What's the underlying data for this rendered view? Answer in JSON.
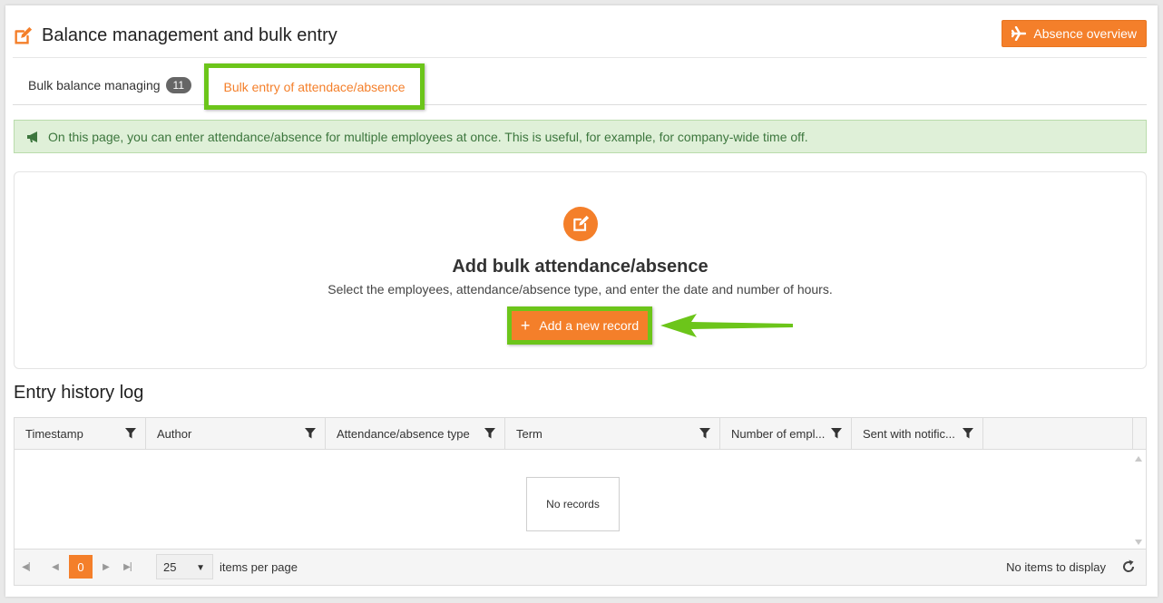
{
  "header": {
    "title": "Balance management and bulk entry",
    "absence_button": "Absence overview"
  },
  "tabs": [
    {
      "label": "Bulk balance managing",
      "badge": "11"
    },
    {
      "label": "Bulk entry of attendace/absence"
    }
  ],
  "info_text": "On this page, you can enter attendance/absence for multiple employees at once. This is useful, for example, for company-wide time off.",
  "card": {
    "title": "Add bulk attendance/absence",
    "description": "Select the employees, attendance/absence type, and enter the date and number of hours.",
    "add_button": "Add a new record"
  },
  "log": {
    "title": "Entry history log",
    "columns": [
      "Timestamp",
      "Author",
      "Attendance/absence type",
      "Term",
      "Number of empl...",
      "Sent with notific..."
    ],
    "empty_text": "No records"
  },
  "pager": {
    "current_page": "0",
    "page_size": "25",
    "items_per_page_label": "items per page",
    "status": "No items to display"
  },
  "colors": {
    "accent": "#f47f2a",
    "highlight": "#6cc51a",
    "info_bg": "#dff0d8"
  }
}
